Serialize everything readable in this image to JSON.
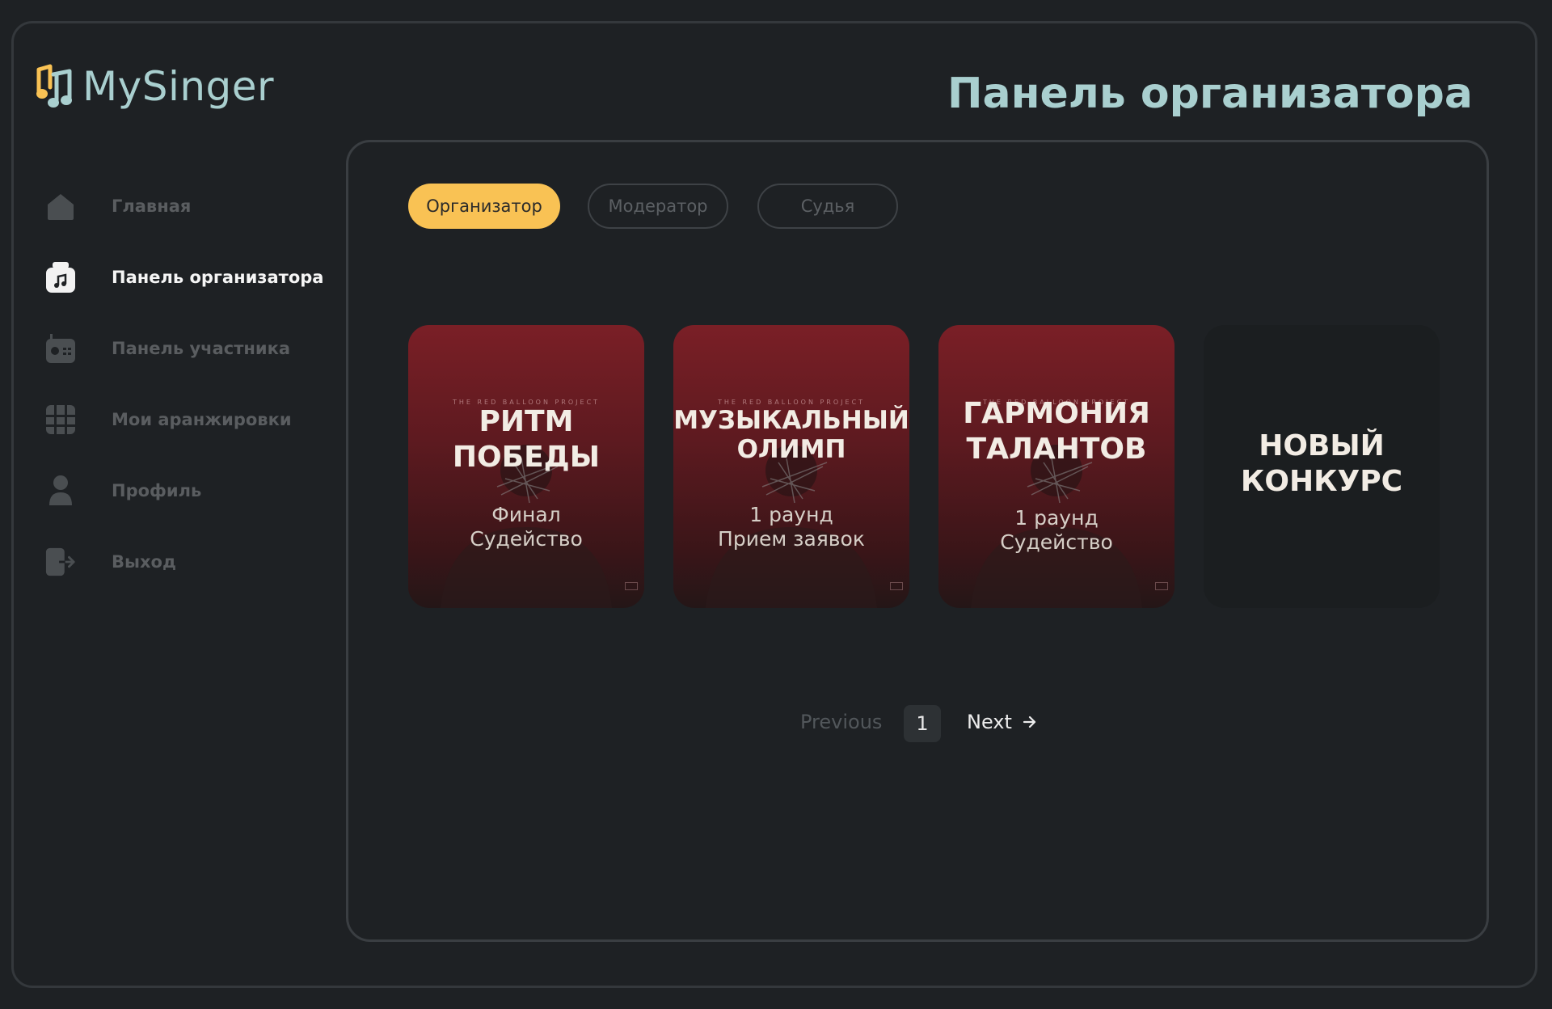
{
  "app": {
    "name": "MySinger",
    "accent": "#f9c254",
    "logo_text_color": "#a9cfcf"
  },
  "header": {
    "title": "Панель организатора"
  },
  "sidebar": {
    "items": [
      {
        "label": "Главная",
        "icon": "home-icon",
        "active": false
      },
      {
        "label": "Панель организатора",
        "icon": "organizer-icon",
        "active": true
      },
      {
        "label": "Панель участника",
        "icon": "radio-icon",
        "active": false
      },
      {
        "label": "Мои аранжировки",
        "icon": "grid-icon",
        "active": false
      },
      {
        "label": "Профиль",
        "icon": "user-icon",
        "active": false
      },
      {
        "label": "Выход",
        "icon": "logout-icon",
        "active": false
      }
    ]
  },
  "tabs": [
    {
      "label": "Организатор",
      "active": true
    },
    {
      "label": "Модератор",
      "active": false
    },
    {
      "label": "Судья",
      "active": false
    }
  ],
  "cards": [
    {
      "brand": "THE RED BALLOON PROJECT",
      "title_lines": [
        "РИТМ",
        "ПОБЕДЫ"
      ],
      "sub_lines": [
        "Финал",
        "Судейство"
      ]
    },
    {
      "brand": "THE RED BALLOON PROJECT",
      "title_lines": [
        "МУЗЫКАЛЬНЫЙ",
        "ОЛИМП"
      ],
      "sub_lines": [
        "1 раунд",
        "Прием заявок"
      ]
    },
    {
      "brand": "THE RED BALLOON PROJECT",
      "title_lines": [
        "ГАРМОНИЯ",
        "ТАЛАНТОВ"
      ],
      "sub_lines": [
        "1 раунд",
        "Судейство"
      ]
    },
    {
      "title_lines": [
        "НОВЫЙ",
        "КОНКУРС"
      ]
    }
  ],
  "pagination": {
    "previous": "Previous",
    "current": "1",
    "next": "Next"
  }
}
